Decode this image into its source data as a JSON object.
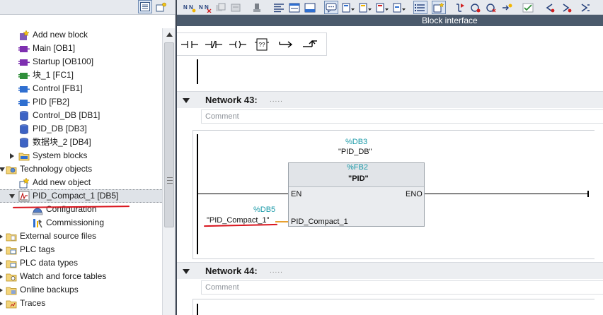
{
  "project_tree": {
    "items": [
      {
        "label": "Add new block",
        "icon": "add-new-block-icon"
      },
      {
        "label": "Main [OB1]",
        "icon": "organization-block-icon"
      },
      {
        "label": "Startup [OB100]",
        "icon": "organization-block-icon"
      },
      {
        "label": "块_1 [FC1]",
        "icon": "function-icon"
      },
      {
        "label": "Control [FB1]",
        "icon": "function-block-icon"
      },
      {
        "label": "PID [FB2]",
        "icon": "function-block-icon"
      },
      {
        "label": "Control_DB [DB1]",
        "icon": "data-block-icon"
      },
      {
        "label": "PID_DB [DB3]",
        "icon": "data-block-icon"
      },
      {
        "label": "数据块_2 [DB4]",
        "icon": "data-block-icon"
      },
      {
        "label": "System blocks",
        "icon": "folder-icon"
      },
      {
        "label": "Technology objects",
        "icon": "technology-objects-icon"
      },
      {
        "label": "Add new object",
        "icon": "add-new-object-icon"
      },
      {
        "label": "PID_Compact_1 [DB5]",
        "icon": "pid-compact-icon"
      },
      {
        "label": "Configuration",
        "icon": "configuration-icon"
      },
      {
        "label": "Commissioning",
        "icon": "commissioning-icon"
      },
      {
        "label": "External source files",
        "icon": "folder-icon"
      },
      {
        "label": "PLC tags",
        "icon": "folder-icon"
      },
      {
        "label": "PLC data types",
        "icon": "folder-icon"
      },
      {
        "label": "Watch and force tables",
        "icon": "folder-icon"
      },
      {
        "label": "Online backups",
        "icon": "folder-icon"
      },
      {
        "label": "Traces",
        "icon": "folder-icon"
      }
    ]
  },
  "editor": {
    "block_interface_label": "Block interface",
    "network43": {
      "title": "Network 43:",
      "dots": ".....",
      "comment_placeholder": "Comment",
      "instance_address": "%DB3",
      "instance_name": "\"PID_DB\"",
      "fb_address": "%FB2",
      "fb_name": "\"PID\"",
      "en_label": "EN",
      "eno_label": "ENO",
      "input_address": "%DB5",
      "input_operand": "\"PID_Compact_1\"",
      "input_pin": "PID_Compact_1"
    },
    "network44": {
      "title": "Network 44:",
      "dots": ".....",
      "comment_placeholder": "Comment"
    }
  },
  "colors": {
    "annotation_red": "#d9161f",
    "address_teal": "#1b9aa8",
    "block_interface_bar": "#4b5a6c",
    "selected_row": "#dfe3e8"
  }
}
